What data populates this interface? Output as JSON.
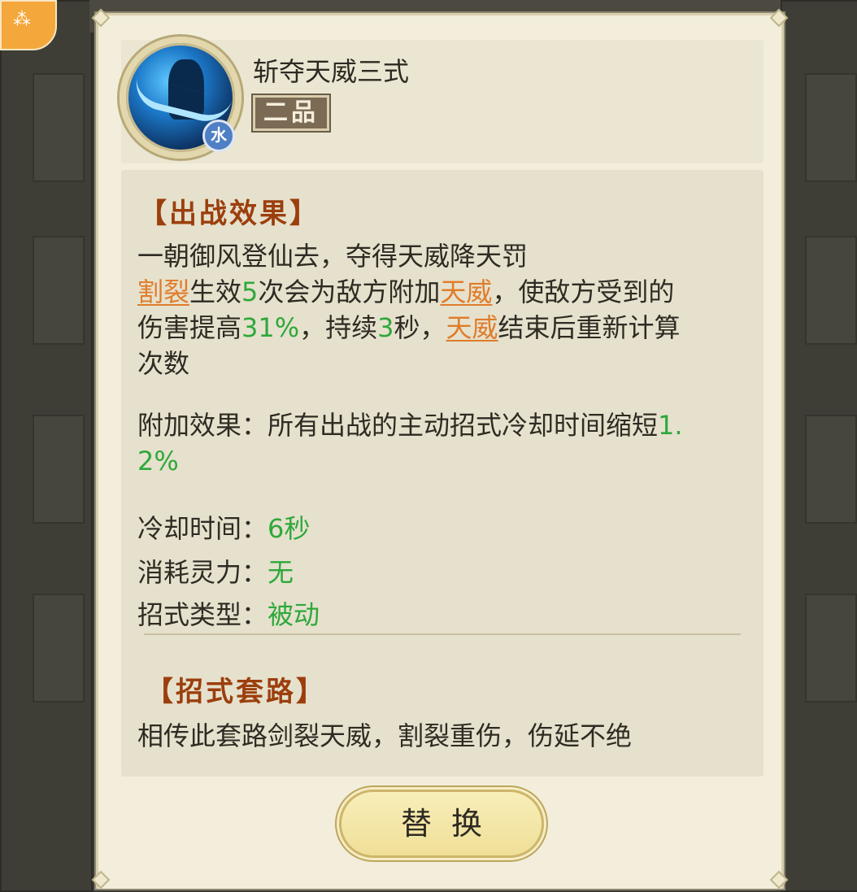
{
  "skill": {
    "name": "斩夺天威三式",
    "grade": "二品",
    "element": "水",
    "icon": "sword-slash-skill-icon"
  },
  "battle_effect": {
    "title": "【出战效果】",
    "line1": "一朝御风登仙去，夺得天威降天罚",
    "desc": {
      "t1": "割裂",
      "t2": "生效",
      "t3": "5",
      "t4": "次会为敌方附加",
      "t5": "天威",
      "t6": "，使敌方受到的",
      "t7": "伤害提高",
      "t8": "31%",
      "t9": "，持续",
      "t10": "3",
      "t11": "秒，",
      "t12": "天威",
      "t13": "结束后重新计算",
      "t14": "次数"
    },
    "extra_label": "附加效果：所有出战的主动招式冷却时间缩短",
    "extra_value_a": "1.",
    "extra_value_b": "2%"
  },
  "stats": {
    "cooldown_label": "冷却时间：",
    "cooldown_value": "6秒",
    "cost_label": "消耗灵力：",
    "cost_value": "无",
    "type_label": "招式类型：",
    "type_value": "被动"
  },
  "routine": {
    "title": "【招式套路】",
    "text": "相传此套路剑裂天威，割裂重伤，伤延不绝"
  },
  "buttons": {
    "replace_label": "替换"
  },
  "colors": {
    "accent_title": "#9b3f0d",
    "highlight_link": "#e07c2a",
    "value_green": "#2fa83c",
    "panel_bg": "#f2eedb",
    "element_badge": "#4f7fc4"
  }
}
